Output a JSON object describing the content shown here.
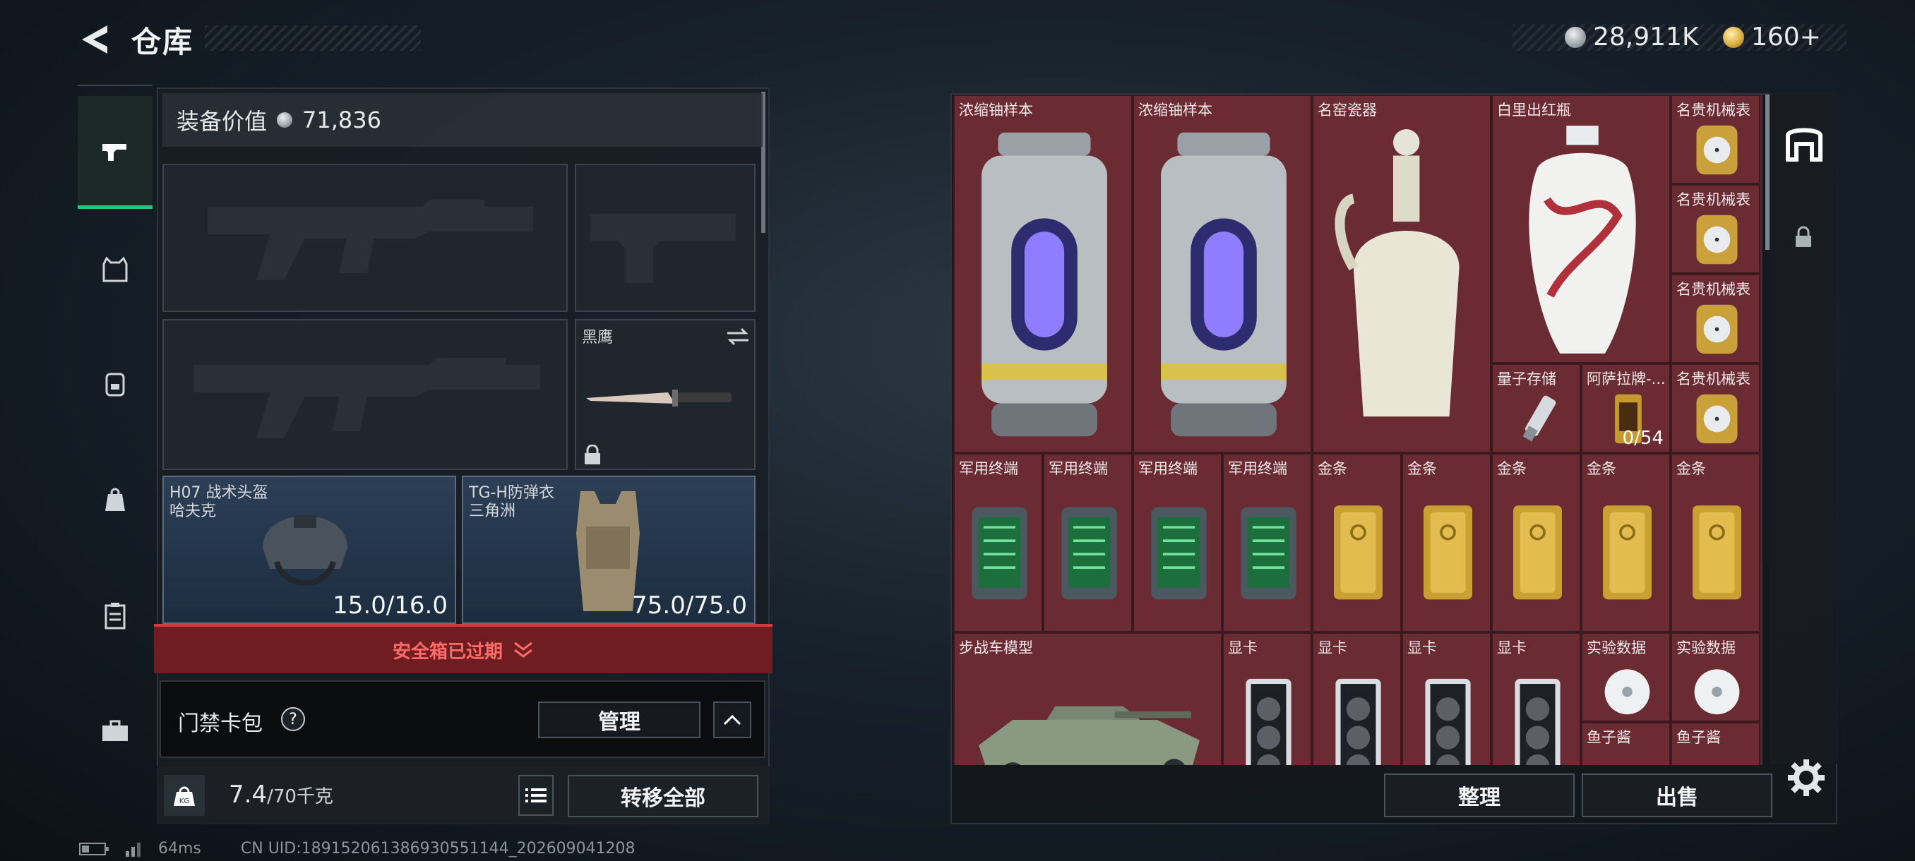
{
  "header": {
    "title": "仓库",
    "currency_silver": "28,911K",
    "currency_gold": "160+"
  },
  "left_rail": {
    "items": [
      "weapon-icon",
      "vest-icon",
      "backpack-icon",
      "bag-icon",
      "clipboard-icon",
      "toolbox-icon"
    ]
  },
  "loadout": {
    "value_label": "装备价值",
    "value": "71,836",
    "melee": {
      "name": "黑鹰"
    },
    "helmet": {
      "name": "H07 战术头盔",
      "sub": "哈夫克",
      "durability": "15.0/16.0"
    },
    "armor": {
      "name": "TG-H防弹衣",
      "sub": "三角洲",
      "durability": "75.0/75.0"
    },
    "safe_box_expired": "安全箱已过期",
    "card_bag": {
      "label": "门禁卡包",
      "help": "?",
      "manage": "管理"
    },
    "weight_current": "7.4",
    "weight_max": "/70千克",
    "transfer_all": "转移全部"
  },
  "stash": {
    "items": [
      {
        "label": "浓缩铀样本",
        "kind": "uranium"
      },
      {
        "label": "浓缩铀样本",
        "kind": "uranium"
      },
      {
        "label": "名窑瓷器",
        "kind": "vase-white"
      },
      {
        "label": "白里出红瓶",
        "kind": "vase-red"
      },
      {
        "label": "名贵机械表",
        "kind": "watch"
      },
      {
        "label": "名贵机械表",
        "kind": "watch"
      },
      {
        "label": "名贵机械表",
        "kind": "watch"
      },
      {
        "label": "量子存储",
        "kind": "usb"
      },
      {
        "label": "阿萨拉牌-...",
        "kind": "card",
        "count": "0/54"
      },
      {
        "label": "名贵机械表",
        "kind": "watch"
      },
      {
        "label": "军用终端",
        "kind": "terminal"
      },
      {
        "label": "军用终端",
        "kind": "terminal"
      },
      {
        "label": "军用终端",
        "kind": "terminal"
      },
      {
        "label": "军用终端",
        "kind": "terminal"
      },
      {
        "label": "金条",
        "kind": "gold"
      },
      {
        "label": "金条",
        "kind": "gold"
      },
      {
        "label": "金条",
        "kind": "gold"
      },
      {
        "label": "金条",
        "kind": "gold"
      },
      {
        "label": "金条",
        "kind": "gold"
      },
      {
        "label": "步战车模型",
        "kind": "tank"
      },
      {
        "label": "显卡",
        "kind": "gpu"
      },
      {
        "label": "显卡",
        "kind": "gpu"
      },
      {
        "label": "显卡",
        "kind": "gpu"
      },
      {
        "label": "显卡",
        "kind": "gpu"
      },
      {
        "label": "实验数据",
        "kind": "disc"
      },
      {
        "label": "实验数据",
        "kind": "disc"
      },
      {
        "label": "鱼子酱",
        "kind": "caviar"
      },
      {
        "label": "鱼子酱",
        "kind": "caviar"
      }
    ],
    "sort_button": "整理",
    "sell_button": "出售"
  },
  "status": {
    "ping": "64ms",
    "uid": "CN UID:18915206138693055114​4_202609041208"
  }
}
